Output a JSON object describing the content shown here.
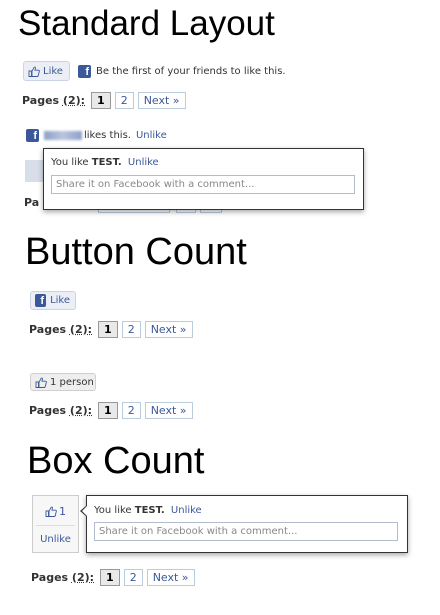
{
  "standard": {
    "heading": "Standard Layout",
    "like_label": "Like",
    "first_text": "Be the first of your friends to like this.",
    "pages_label": "Pages",
    "pages_count": "(2):",
    "page_1": "1",
    "page_2": "2",
    "next_label": "Next »",
    "likes_this": "likes this.",
    "unlike": "Unlike",
    "popup_you_like": "You like",
    "popup_name": "TEST.",
    "popup_unlike": "Unlike",
    "comment_placeholder": "Share it on Facebook with a comment...",
    "hidden_pages_label": "Pa"
  },
  "button_count": {
    "heading": "Button Count",
    "like_label": "Like",
    "pages_label": "Pages",
    "pages_count": "(2):",
    "page_1": "1",
    "page_2": "2",
    "next_label": "Next »"
  },
  "button_count_liked": {
    "count_label": "1 person",
    "pages_label": "Pages",
    "pages_count": "(2):",
    "page_1": "1",
    "page_2": "2",
    "next_label": "Next »"
  },
  "box_count": {
    "heading": "Box Count",
    "count": "1",
    "unlike": "Unlike",
    "popup_you_like": "You like",
    "popup_name": "TEST.",
    "popup_unlike": "Unlike",
    "comment_placeholder": "Share it on Facebook with a comment...",
    "pages_label": "Pages",
    "pages_count": "(2):",
    "page_1": "1",
    "page_2": "2",
    "next_label": "Next »"
  },
  "colors": {
    "facebook_blue": "#3b5998",
    "button_bg": "#eceef5"
  },
  "icons": [
    "thumbs-up-icon",
    "facebook-icon"
  ]
}
